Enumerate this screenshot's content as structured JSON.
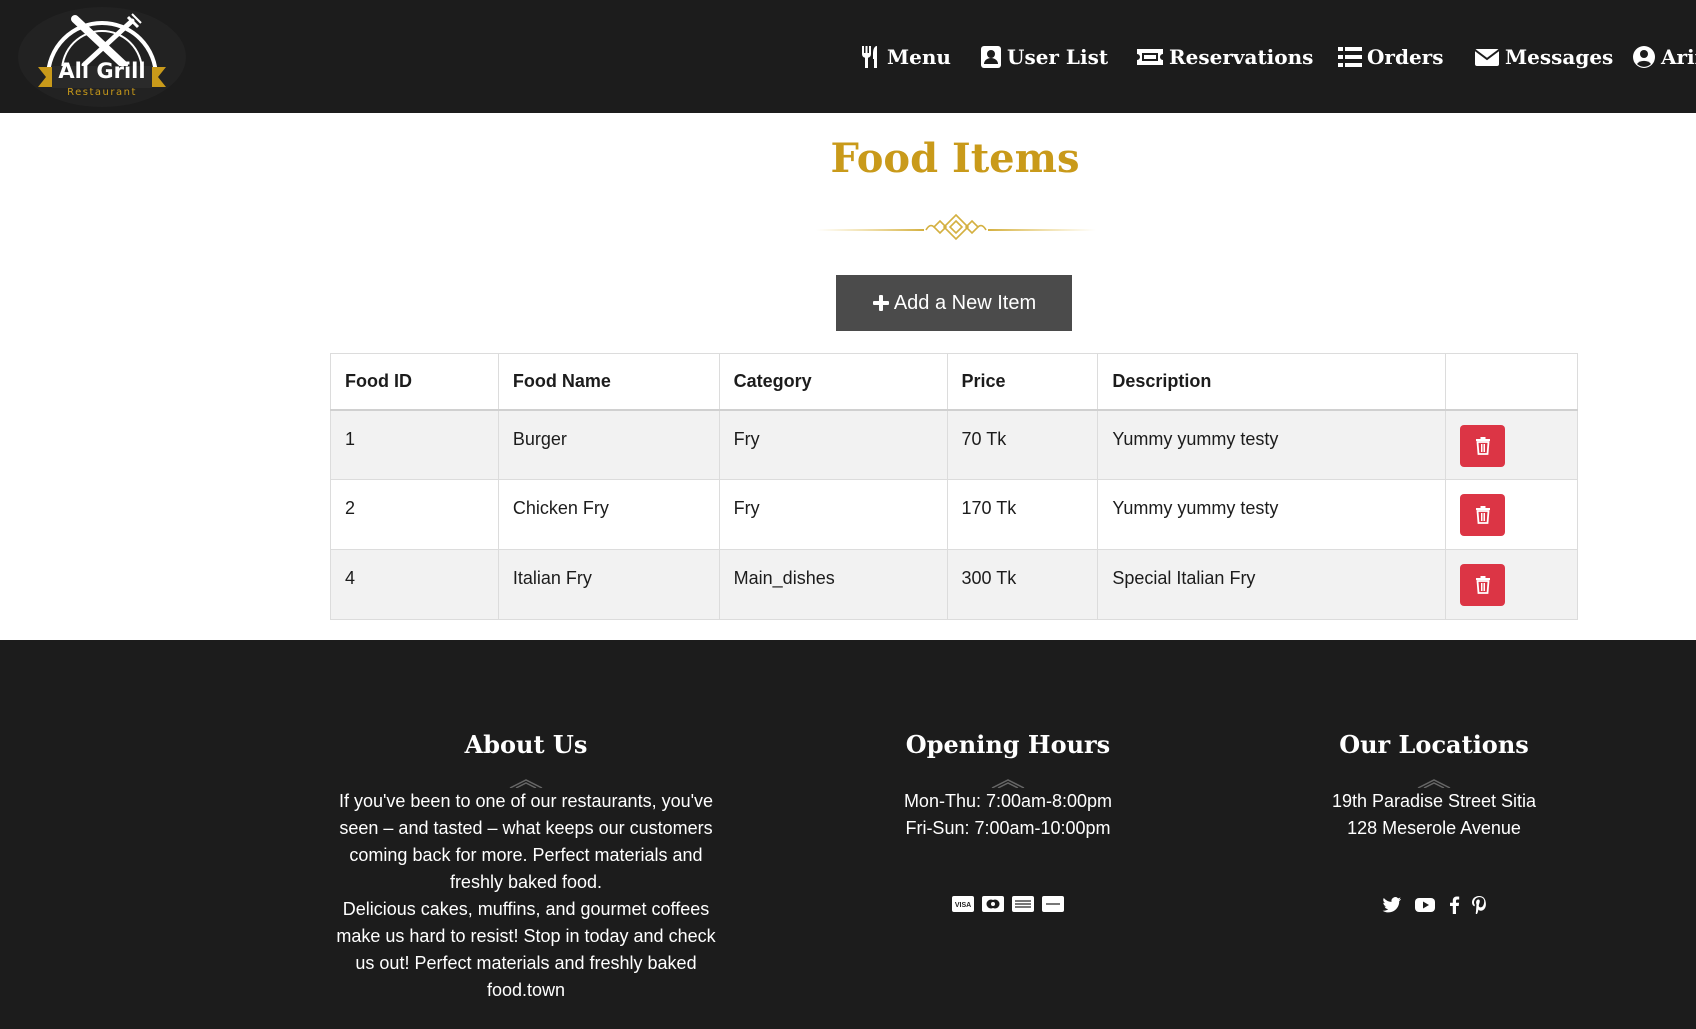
{
  "brand": {
    "name": "All Grill",
    "tagline": "Restaurant"
  },
  "nav": {
    "items": [
      {
        "label": "Menu",
        "icon": "utensils-icon"
      },
      {
        "label": "User List",
        "icon": "contact-card-icon"
      },
      {
        "label": "Reservations",
        "icon": "ticket-icon"
      },
      {
        "label": "Orders",
        "icon": "list-icon"
      },
      {
        "label": "Messages",
        "icon": "envelope-icon"
      },
      {
        "label": "Arif",
        "icon": "user-circle-icon"
      }
    ]
  },
  "main": {
    "title": "Food Items",
    "add_button_label": "Add a New Item"
  },
  "table": {
    "headers": [
      "Food ID",
      "Food Name",
      "Category",
      "Price",
      "Description",
      ""
    ],
    "rows": [
      {
        "id": "1",
        "name": "Burger",
        "category": "Fry",
        "price": "70 Tk",
        "description": "Yummy yummy testy"
      },
      {
        "id": "2",
        "name": "Chicken Fry",
        "category": "Fry",
        "price": "170 Tk",
        "description": "Yummy yummy testy"
      },
      {
        "id": "4",
        "name": "Italian Fry",
        "category": "Main_dishes",
        "price": "300 Tk",
        "description": "Special Italian Fry"
      }
    ]
  },
  "footer": {
    "about": {
      "heading": "About Us",
      "text1": "If you've been to one of our restaurants, you've seen – and tasted – what keeps our customers coming back for more. Perfect materials and freshly baked food.",
      "text2": "Delicious cakes, muffins, and gourmet coffees make us hard to resist! Stop in today and check us out! Perfect materials and freshly baked food.town"
    },
    "hours": {
      "heading": "Opening Hours",
      "line1": "Mon-Thu: 7:00am-8:00pm",
      "line2": "Fri-Sun: 7:00am-10:00pm",
      "payment_icons": [
        "visa-icon",
        "mastercard-icon",
        "amex-icon",
        "paypal-icon"
      ]
    },
    "locations": {
      "heading": "Our Locations",
      "line1": "19th Paradise Street Sitia",
      "line2": "128 Meserole Avenue",
      "social_icons": [
        "twitter-icon",
        "youtube-icon",
        "facebook-icon",
        "pinterest-icon"
      ]
    }
  },
  "colors": {
    "dark_bg": "#1c1c1c",
    "accent_gold": "#c99a1a",
    "button_dark": "#4b4b4b",
    "delete_red": "#dc3545",
    "row_stripe": "#f2f2f2"
  }
}
